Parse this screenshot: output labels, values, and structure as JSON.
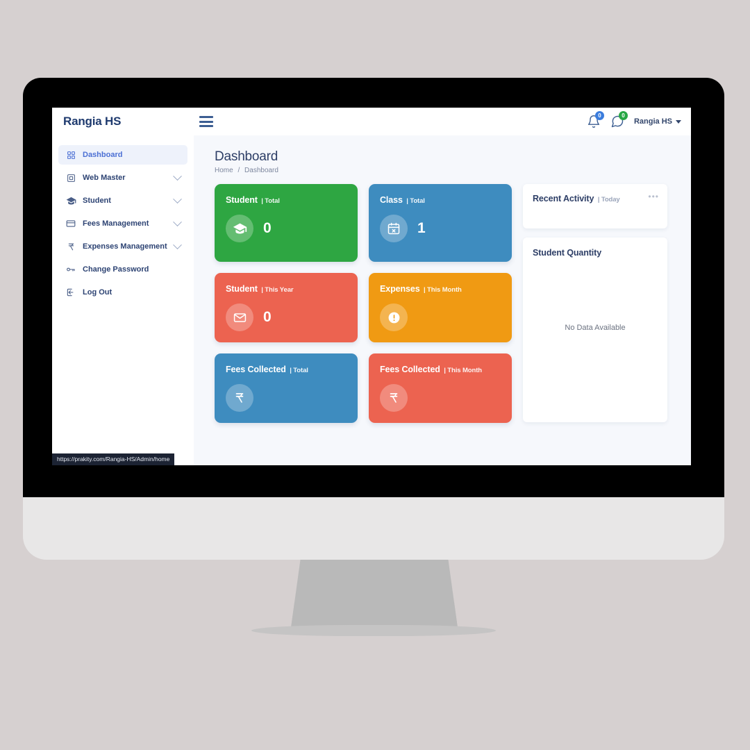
{
  "browser": {
    "status_url": "https://prakity.com/Rangia-HS/Admin/home"
  },
  "navbar": {
    "brand": "Rangia HS",
    "menu_toggle": "hamburger-menu",
    "notifications": {
      "icon": "bell-icon",
      "count": "0",
      "color": "#3b7ddd"
    },
    "messages": {
      "icon": "message-icon",
      "count": "0",
      "color": "#28a745"
    },
    "user": {
      "name": "Rangia HS",
      "caret": "caret-down-icon"
    }
  },
  "sidebar": {
    "items": [
      {
        "label": "Dashboard",
        "icon": "grid-icon",
        "active": true,
        "expandable": false
      },
      {
        "label": "Web Master",
        "icon": "window-icon",
        "active": false,
        "expandable": true
      },
      {
        "label": "Student",
        "icon": "graduation-icon",
        "active": false,
        "expandable": true
      },
      {
        "label": "Fees Management",
        "icon": "credit-card-icon",
        "active": false,
        "expandable": true
      },
      {
        "label": "Expenses Management",
        "icon": "rupee-icon",
        "active": false,
        "expandable": true
      },
      {
        "label": "Change Password",
        "icon": "key-icon",
        "active": false,
        "expandable": false
      },
      {
        "label": "Log Out",
        "icon": "logout-icon",
        "active": false,
        "expandable": false
      }
    ]
  },
  "page": {
    "title": "Dashboard",
    "breadcrumb": {
      "home": "Home",
      "separator": "/",
      "current": "Dashboard"
    }
  },
  "stats": [
    {
      "title": "Student",
      "sub": "| Total",
      "value": "0",
      "icon": "graduation-cap-icon",
      "color": "#2ea642",
      "theme": "c-green",
      "size": "tall"
    },
    {
      "title": "Class",
      "sub": "| Total",
      "value": "1",
      "icon": "calendar-x-icon",
      "color": "#3e8cbf",
      "theme": "c-blue",
      "size": "tall"
    },
    {
      "title": "Student",
      "sub": "| This Year",
      "value": "0",
      "icon": "envelope-icon",
      "color": "#ec6350",
      "theme": "c-coral",
      "size": "short"
    },
    {
      "title": "Expenses",
      "sub": "| This Month",
      "value": "",
      "icon": "exclamation-icon",
      "color": "#f09a13",
      "theme": "c-orange",
      "size": "short"
    },
    {
      "title": "Fees Collected",
      "sub": "| Total",
      "value": "",
      "icon": "rupee-icon",
      "color": "#3e8cbf",
      "theme": "c-blue",
      "size": "short"
    },
    {
      "title": "Fees Collected",
      "sub": "| This Month",
      "value": "",
      "icon": "rupee-icon",
      "color": "#ec6350",
      "theme": "c-coral",
      "size": "short"
    }
  ],
  "panels": {
    "recent_activity": {
      "title": "Recent Activity",
      "sub": "| Today",
      "more": "•••"
    },
    "student_quantity": {
      "title": "Student Quantity",
      "empty_text": "No Data Available"
    }
  }
}
